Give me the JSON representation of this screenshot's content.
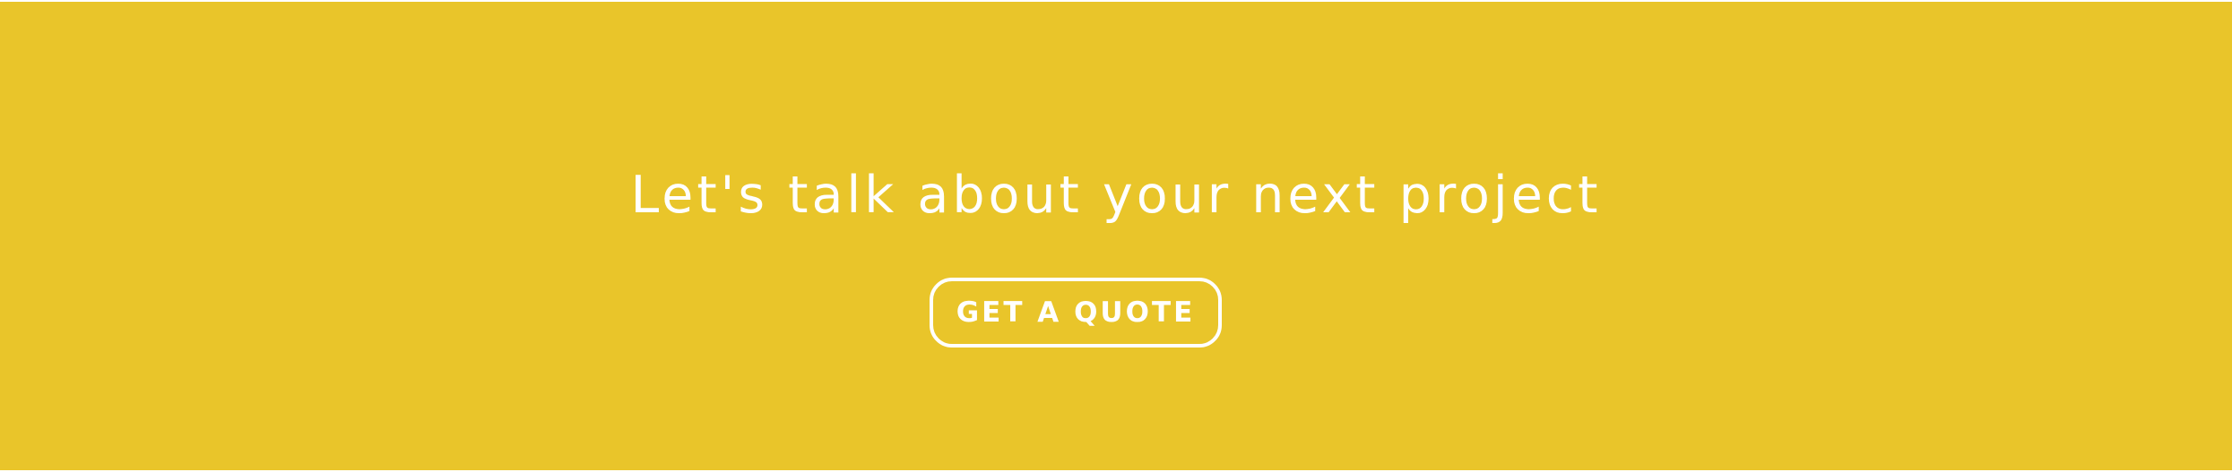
{
  "banner": {
    "headline": "Let's talk about your next project",
    "cta_label": "GET A QUOTE",
    "background_color": "#E9C52A",
    "text_color": "#FFFFFF"
  }
}
